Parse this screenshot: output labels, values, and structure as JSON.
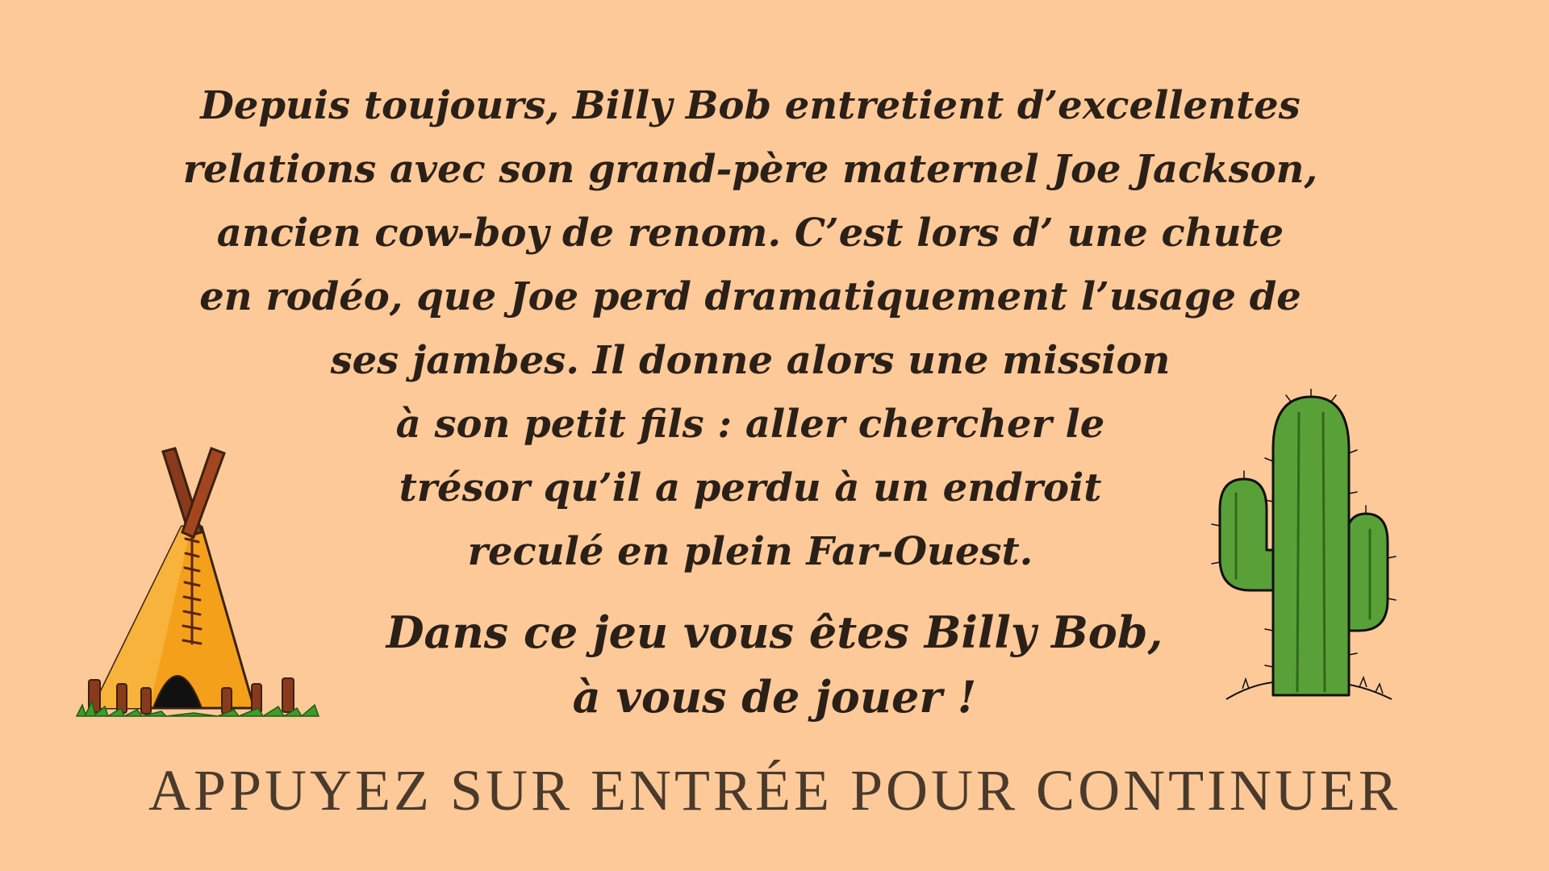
{
  "story": {
    "lines": [
      "Depuis toujours, Billy Bob entretient d’excellentes",
      "relations avec son grand-père maternel Joe Jackson,",
      "ancien cow-boy de renom. C’est lors d’ une chute",
      "en rodéo, que Joe perd dramatiquement l’usage de",
      "ses jambes. Il donne alors une mission",
      "à son petit fils : aller chercher le",
      "trésor qu’il a perdu à un endroit",
      "reculé en plein Far-Ouest."
    ]
  },
  "call_to_action": {
    "lines": [
      "Dans ce jeu vous êtes Billy Bob,",
      "à vous de jouer !"
    ]
  },
  "prompt": {
    "continue_label": "APPUYEZ SUR ENTRÉE POUR CONTINUER"
  },
  "decorations": {
    "left_icon": "teepee-icon",
    "right_icon": "cactus-icon"
  },
  "colors": {
    "background": "#fdc999",
    "text": "#2b2018",
    "prompt_text": "#4a3a2c",
    "teepee_fill": "#f5a01a",
    "teepee_poles": "#8a3a1c",
    "cactus_fill": "#5aa038",
    "grass": "#3f9a2a"
  }
}
